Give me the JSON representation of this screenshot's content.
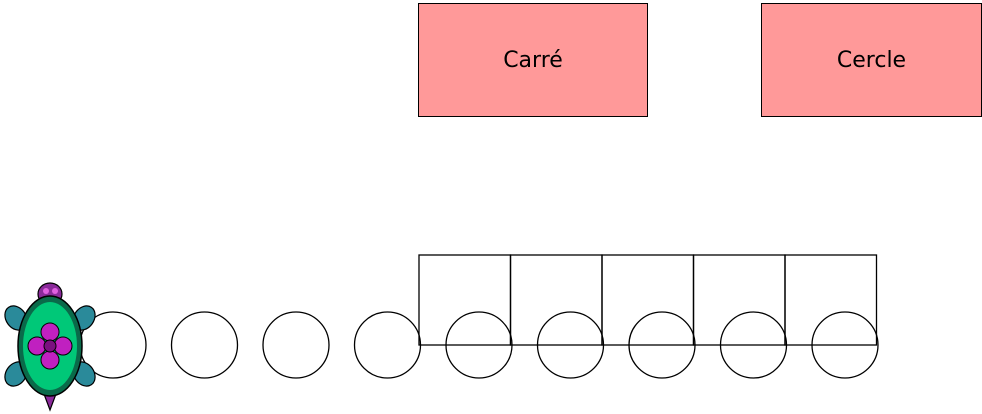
{
  "buttons": {
    "square_label": "Carré",
    "circle_label": "Cercle"
  },
  "colors": {
    "button_fill": "#ff9999",
    "stroke": "#000000",
    "turtle_shell": "#00c878",
    "turtle_shell_dark": "#0a6a4a",
    "turtle_flower": "#c020c0",
    "turtle_limbs": "#2a8a9a",
    "turtle_head": "#8a2a9a"
  },
  "icons": {
    "turtle": "turtle-icon"
  },
  "drawing": {
    "circle_count": 9,
    "square_count": 5
  }
}
